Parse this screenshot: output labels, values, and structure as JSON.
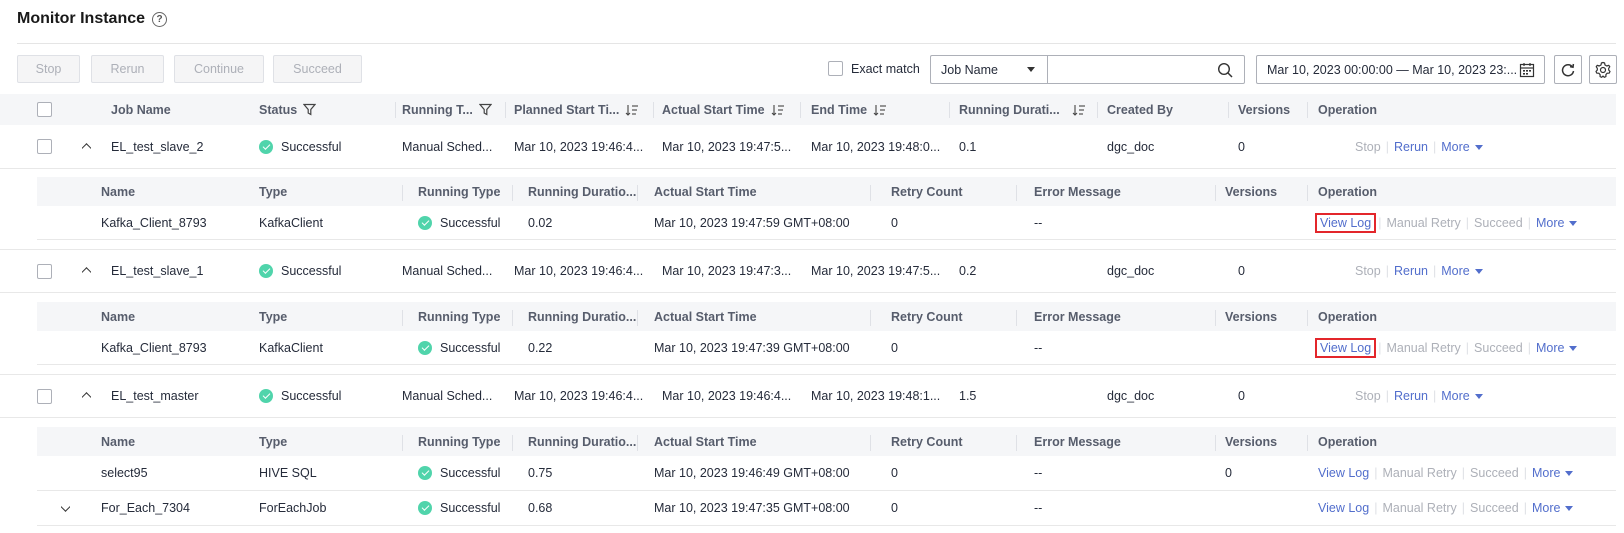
{
  "page": {
    "title": "Monitor Instance",
    "help_glyph": "?"
  },
  "toolbar": {
    "stop": "Stop",
    "rerun": "Rerun",
    "continue": "Continue",
    "succeed": "Succeed",
    "exact_match": "Exact match",
    "search_field": "Job Name",
    "search_value": "",
    "date_range": "Mar 10, 2023 00:00:00 — Mar 10, 2023 23:..."
  },
  "columns": {
    "job_name": "Job Name",
    "status": "Status",
    "running_type": "Running T...",
    "planned_start": "Planned Start Ti...",
    "actual_start": "Actual Start Time",
    "end_time": "End Time",
    "running_duration": "Running Durati...",
    "created_by": "Created By",
    "versions": "Versions",
    "operation": "Operation"
  },
  "sub_columns": {
    "name": "Name",
    "type": "Type",
    "running_type": "Running Type",
    "running_duration": "Running Duratio...",
    "actual_start": "Actual Start Time",
    "retry_count": "Retry Count",
    "error_message": "Error Message",
    "versions": "Versions",
    "operation": "Operation"
  },
  "actions": {
    "stop": "Stop",
    "rerun": "Rerun",
    "more": "More",
    "view_log": "View Log",
    "manual_retry": "Manual Retry",
    "succeed": "Succeed"
  },
  "jobs": [
    {
      "name": "EL_test_slave_2",
      "status": "Successful",
      "running_type": "Manual Sched...",
      "planned_start": "Mar 10, 2023 19:46:4...",
      "actual_start": "Mar 10, 2023 19:47:5...",
      "end_time": "Mar 10, 2023 19:48:0...",
      "duration": "0.1",
      "created_by": "dgc_doc",
      "versions": "0",
      "nodes": [
        {
          "name": "Kafka_Client_8793",
          "type": "KafkaClient",
          "status": "Successful",
          "duration": "0.02",
          "actual_start": "Mar 10, 2023 19:47:59 GMT+08:00",
          "retry": "0",
          "error": "--",
          "versions": ""
        }
      ]
    },
    {
      "name": "EL_test_slave_1",
      "status": "Successful",
      "running_type": "Manual Sched...",
      "planned_start": "Mar 10, 2023 19:46:4...",
      "actual_start": "Mar 10, 2023 19:47:3...",
      "end_time": "Mar 10, 2023 19:47:5...",
      "duration": "0.2",
      "created_by": "dgc_doc",
      "versions": "0",
      "nodes": [
        {
          "name": "Kafka_Client_8793",
          "type": "KafkaClient",
          "status": "Successful",
          "duration": "0.22",
          "actual_start": "Mar 10, 2023 19:47:39 GMT+08:00",
          "retry": "0",
          "error": "--",
          "versions": ""
        }
      ]
    },
    {
      "name": "EL_test_master",
      "status": "Successful",
      "running_type": "Manual Sched...",
      "planned_start": "Mar 10, 2023 19:46:4...",
      "actual_start": "Mar 10, 2023 19:46:4...",
      "end_time": "Mar 10, 2023 19:48:1...",
      "duration": "1.5",
      "created_by": "dgc_doc",
      "versions": "0",
      "nodes": [
        {
          "name": "select95",
          "type": "HIVE SQL",
          "status": "Successful",
          "duration": "0.75",
          "actual_start": "Mar 10, 2023 19:46:49 GMT+08:00",
          "retry": "0",
          "error": "--",
          "versions": "0"
        },
        {
          "name": "For_Each_7304",
          "type": "ForEachJob",
          "status": "Successful",
          "duration": "0.68",
          "actual_start": "Mar 10, 2023 19:47:35 GMT+08:00",
          "retry": "0",
          "error": "--",
          "versions": ""
        }
      ]
    }
  ],
  "colors": {
    "link": "#526ecc",
    "disabled": "#adb0b8",
    "success": "#50d4ab",
    "highlight": "#e3262b"
  }
}
